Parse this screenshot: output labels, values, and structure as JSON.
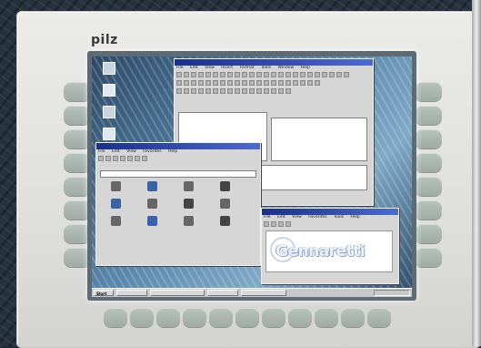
{
  "device": {
    "brand": "pilz"
  },
  "screen": {
    "main_window": {
      "title": "",
      "menu": [
        "File",
        "Edit",
        "View",
        "Insert",
        "Format",
        "Tools",
        "Window",
        "Help"
      ]
    },
    "project_window": {
      "title": "",
      "menu": [
        "File",
        "Edit",
        "View",
        "Favorites",
        "Help"
      ]
    },
    "logo_window": {
      "title": "",
      "menu": [
        "File",
        "Edit",
        "View",
        "Favorites",
        "Tools",
        "Help"
      ],
      "logo_text": "Gennaretti"
    },
    "taskbar": {
      "start_label": "Start",
      "clock": ""
    }
  },
  "colors": {
    "titlebar": "#1a2f8a",
    "device_body": "#e6e6e3",
    "keys": "#a9b4ad"
  }
}
